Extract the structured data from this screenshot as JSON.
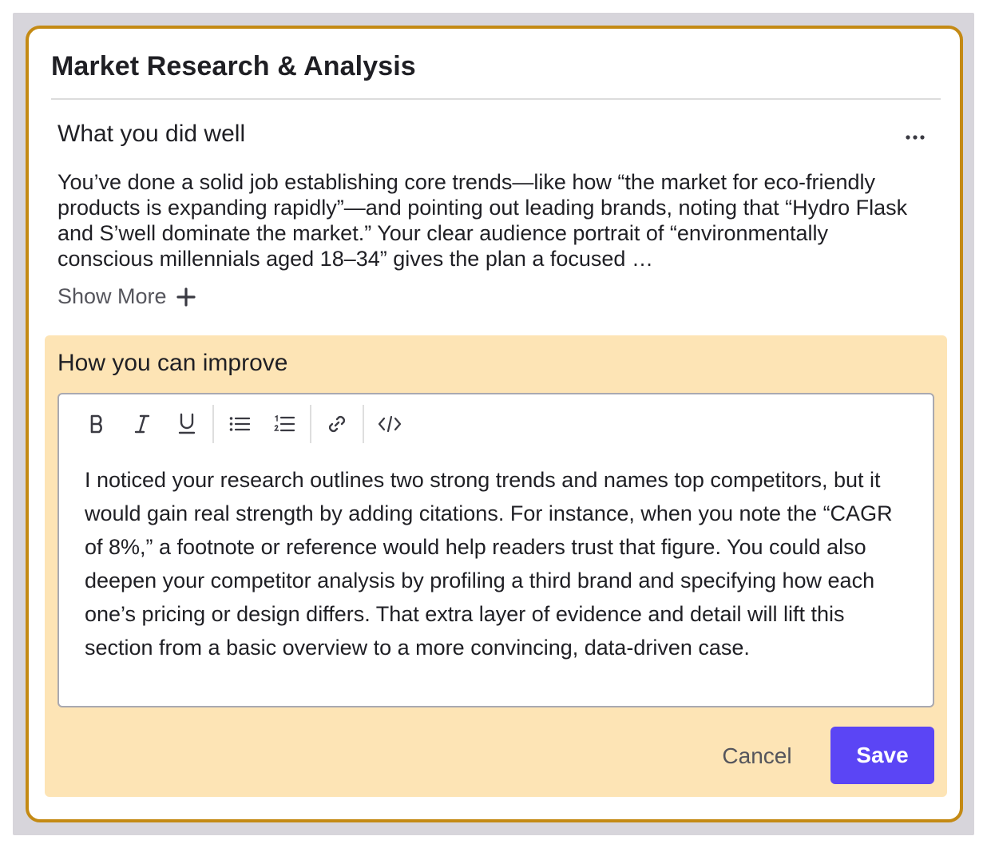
{
  "card": {
    "title": "Market Research & Analysis"
  },
  "well_section": {
    "heading": "What you did well",
    "more_icon": "ellipsis-horizontal-icon",
    "body": "You’ve done a solid job establishing core trends—like how “the market for eco-friendly products is expanding rapidly”—and pointing out leading brands, noting that “Hydro Flask and S’well dominate the market.” Your clear audience portrait of “environmentally conscious millennials aged 18–34” gives the plan a focused …",
    "show_more_label": "Show More",
    "show_more_icon": "plus-icon"
  },
  "improve_section": {
    "heading": "How you can improve",
    "background_color": "#fde4b5",
    "toolbar": [
      {
        "name": "bold-icon"
      },
      {
        "name": "italic-icon"
      },
      {
        "name": "underline-icon"
      },
      {
        "name": "bullet-list-icon"
      },
      {
        "name": "numbered-list-icon"
      },
      {
        "name": "link-icon"
      },
      {
        "name": "code-icon"
      }
    ],
    "editor_text": "I noticed your research outlines two strong trends and names top competitors, but it would gain real strength by adding citations. For instance, when you note the “CAGR of 8%,” a footnote or reference would help readers trust that figure. You could also deepen your competitor analysis by profiling a third brand and specifying how each one’s pricing or design differs. That extra layer of evidence and detail will lift this section from a basic overview to a more convincing, data-driven case.",
    "cancel_label": "Cancel",
    "save_label": "Save"
  },
  "colors": {
    "card_border": "#c48a14",
    "primary_button": "#5b45f5",
    "backdrop": "#d7d5db"
  }
}
